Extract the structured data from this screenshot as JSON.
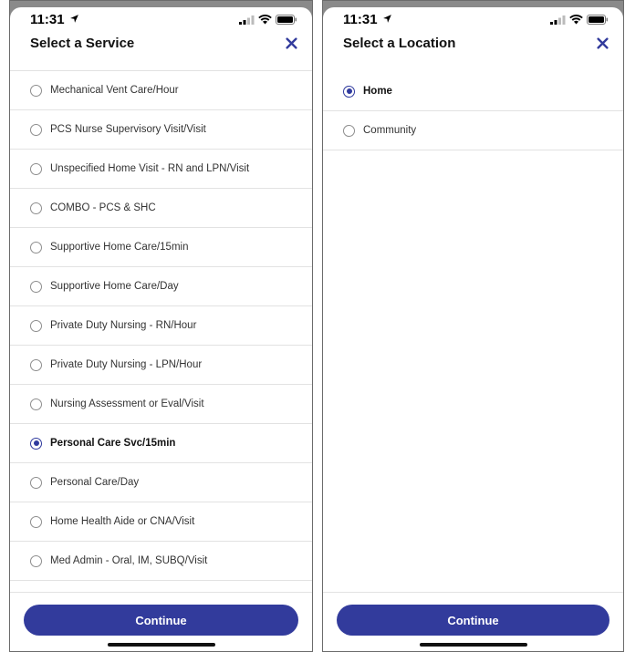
{
  "left_screen": {
    "status_bar": {
      "time": "11:31"
    },
    "title": "Select a Service",
    "services": [
      {
        "label": "Mechanical Vent Care/Hour",
        "selected": false
      },
      {
        "label": "PCS Nurse Supervisory Visit/Visit",
        "selected": false
      },
      {
        "label": "Unspecified Home Visit - RN and LPN/Visit",
        "selected": false
      },
      {
        "label": "COMBO - PCS & SHC",
        "selected": false
      },
      {
        "label": "Supportive Home Care/15min",
        "selected": false
      },
      {
        "label": "Supportive Home Care/Day",
        "selected": false
      },
      {
        "label": "Private Duty Nursing - RN/Hour",
        "selected": false
      },
      {
        "label": "Private Duty Nursing - LPN/Hour",
        "selected": false
      },
      {
        "label": "Nursing Assessment or Eval/Visit",
        "selected": false
      },
      {
        "label": "Personal Care Svc/15min",
        "selected": true
      },
      {
        "label": "Personal Care/Day",
        "selected": false
      },
      {
        "label": "Home Health Aide or CNA/Visit",
        "selected": false
      },
      {
        "label": "Med Admin - Oral, IM, SUBQ/Visit",
        "selected": false
      }
    ],
    "continue_label": "Continue"
  },
  "right_screen": {
    "status_bar": {
      "time": "11:31"
    },
    "title": "Select a Location",
    "locations": [
      {
        "label": "Home",
        "selected": true
      },
      {
        "label": "Community",
        "selected": false
      }
    ],
    "continue_label": "Continue"
  },
  "colors": {
    "accent": "#323b9c",
    "divider": "#e2e2e2",
    "backdrop": "#8a8a8a"
  },
  "icons": [
    "location-arrow-icon",
    "signal-icon",
    "wifi-icon",
    "battery-icon",
    "close-icon",
    "radio-icon"
  ]
}
